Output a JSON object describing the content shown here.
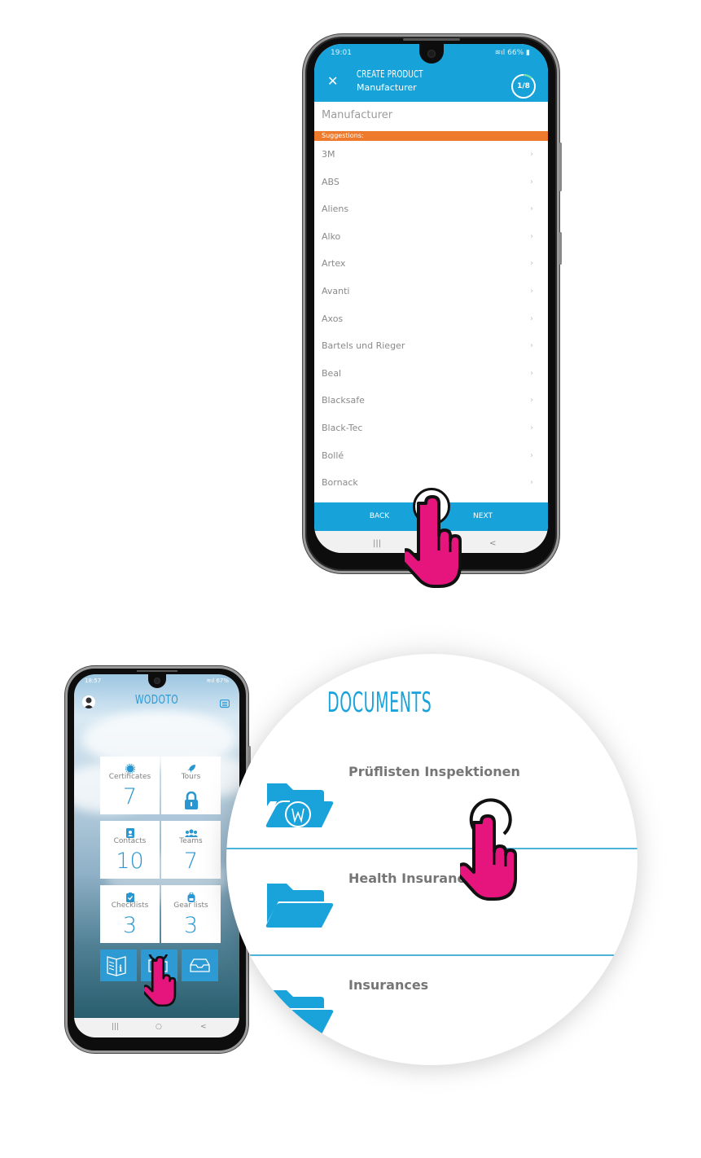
{
  "phone_create_product": {
    "status_bar": {
      "time": "19:01",
      "battery": "66%"
    },
    "header": {
      "close_icon": "close-icon",
      "title": "CREATE PRODUCT",
      "subtitle": "Manufacturer",
      "step_progress": "1/8",
      "step_current": 1,
      "step_total": 8
    },
    "search": {
      "placeholder": "Manufacturer",
      "value": ""
    },
    "suggestions_label": "Suggestions:",
    "manufacturers": [
      "3M",
      "ABS",
      "Aliens",
      "Alko",
      "Artex",
      "Avanti",
      "Axos",
      "Bartels und Rieger",
      "Beal",
      "Blacksafe",
      "Black-Tec",
      "Bollé",
      "Bornack"
    ],
    "footer": {
      "back_label": "BACK",
      "next_label": "NEXT",
      "mic_icon": "microphone-icon"
    },
    "nav": {
      "recent": "|||",
      "back": "<"
    }
  },
  "phone_dashboard": {
    "status_bar": {
      "time": "18:57",
      "battery": "67%"
    },
    "brand": "WODOTO",
    "tiles": [
      {
        "label": "Certificates",
        "value": "7",
        "icon": "badge-icon"
      },
      {
        "label": "Tours",
        "value": "",
        "icon": "rocket-icon",
        "locked": true
      },
      {
        "label": "Contacts",
        "value": "10",
        "icon": "contact-card-icon"
      },
      {
        "label": "Teams",
        "value": "7",
        "icon": "users-icon"
      },
      {
        "label": "Checklists",
        "value": "3",
        "icon": "clipboard-check-icon"
      },
      {
        "label": "Gear lists",
        "value": "3",
        "icon": "backpack-icon"
      }
    ],
    "bottom_buttons": [
      "manual-info-icon",
      "folder-icon",
      "inbox-tray-icon"
    ],
    "nav": {
      "recent": "|||",
      "home": "○",
      "back": "<"
    }
  },
  "documents_zoom": {
    "title": "DOCUMENTS",
    "items": [
      {
        "name": "Prüflisten Inspektionen",
        "icon": "folder-w-logo-icon"
      },
      {
        "name": "Health Insurance",
        "icon": "folder-open-icon"
      },
      {
        "name": "Insurances",
        "icon": "folder-open-icon"
      }
    ]
  },
  "colors": {
    "primary_blue": "#17a2da",
    "suggestion_orange": "#ee7a2d",
    "hand_pink": "#e5157d",
    "text_grey": "#8a8a8a"
  }
}
